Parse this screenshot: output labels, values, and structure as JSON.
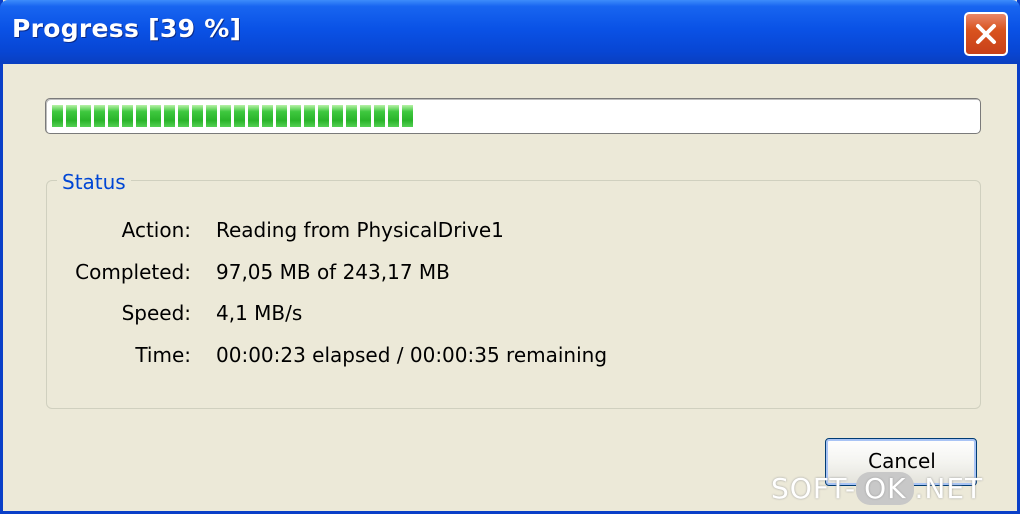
{
  "window": {
    "title": "Progress [39 %]"
  },
  "progress": {
    "fraction": 0.39
  },
  "status": {
    "group_label": "Status",
    "rows": [
      {
        "label": "Action:",
        "value": "Reading from PhysicalDrive1"
      },
      {
        "label": "Completed:",
        "value": "97,05 MB of 243,17 MB"
      },
      {
        "label": "Speed:",
        "value": "4,1 MB/s"
      },
      {
        "label": "Time:",
        "value": "00:00:23 elapsed / 00:00:35 remaining"
      }
    ]
  },
  "buttons": {
    "cancel_label": "Cancel"
  },
  "watermark": {
    "prefix": "SOFT-",
    "middle": "OK",
    "suffix": ".NET"
  },
  "icons": {
    "close": "close-icon"
  },
  "colors": {
    "titlebar": "#0A52E6",
    "progress": "#2AB42A",
    "group_label": "#0046D5",
    "close_button": "#D9531E"
  }
}
